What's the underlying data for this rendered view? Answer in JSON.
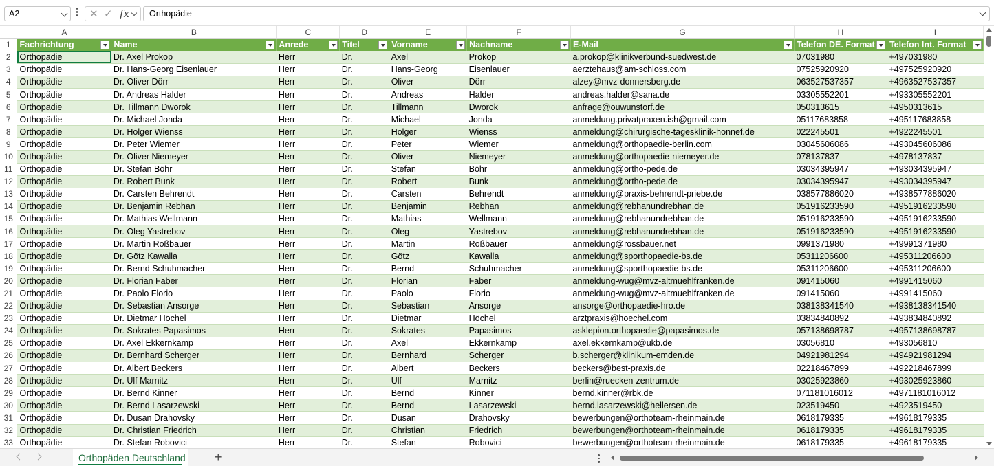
{
  "formula_bar": {
    "name_box": "A2",
    "fx_label": "fx",
    "formula_value": "Orthopädie"
  },
  "columns": [
    "A",
    "B",
    "C",
    "D",
    "E",
    "F",
    "G",
    "H",
    "I"
  ],
  "header_row_number": "1",
  "headers": [
    "Fachrichtung",
    "Name",
    "Anrede",
    "Titel",
    "Vorname",
    "Nachname",
    "E-Mail",
    "Telefon DE. Format",
    "Telefon Int. Format"
  ],
  "rows": [
    {
      "n": "2",
      "cells": [
        "Orthopädie",
        "Dr. Axel Prokop",
        "Herr",
        "Dr.",
        "Axel",
        "Prokop",
        "a.prokop@klinikverbund-suedwest.de",
        "07031980",
        "+497031980"
      ]
    },
    {
      "n": "3",
      "cells": [
        "Orthopädie",
        "Dr. Hans-Georg Eisenlauer",
        "Herr",
        "Dr.",
        "Hans-Georg",
        "Eisenlauer",
        "aerztehaus@am-schloss.com",
        "07525920920",
        "+497525920920"
      ]
    },
    {
      "n": "4",
      "cells": [
        "Orthopädie",
        "Dr. Oliver Dörr",
        "Herr",
        "Dr.",
        "Oliver",
        "Dörr",
        "alzey@mvz-donnersberg.de",
        "063527537357",
        "+4963527537357"
      ]
    },
    {
      "n": "5",
      "cells": [
        "Orthopädie",
        "Dr. Andreas Halder",
        "Herr",
        "Dr.",
        "Andreas",
        "Halder",
        "andreas.halder@sana.de",
        "03305552201",
        "+493305552201"
      ]
    },
    {
      "n": "6",
      "cells": [
        "Orthopädie",
        "Dr. Tillmann Dworok",
        "Herr",
        "Dr.",
        "Tillmann",
        "Dworok",
        "anfrage@ouwunstorf.de",
        "050313615",
        "+4950313615"
      ]
    },
    {
      "n": "7",
      "cells": [
        "Orthopädie",
        "Dr. Michael Jonda",
        "Herr",
        "Dr.",
        "Michael",
        "Jonda",
        "anmeldung.privatpraxen.ish@gmail.com",
        "05117683858",
        "+495117683858"
      ]
    },
    {
      "n": "8",
      "cells": [
        "Orthopädie",
        "Dr. Holger Wienss",
        "Herr",
        "Dr.",
        "Holger",
        "Wienss",
        "anmeldung@chirurgische-tagesklinik-honnef.de",
        "022245501",
        "+4922245501"
      ]
    },
    {
      "n": "9",
      "cells": [
        "Orthopädie",
        "Dr. Peter Wiemer",
        "Herr",
        "Dr.",
        "Peter",
        "Wiemer",
        "anmeldung@orthopaedie-berlin.com",
        "03045606086",
        "+493045606086"
      ]
    },
    {
      "n": "10",
      "cells": [
        "Orthopädie",
        "Dr. Oliver Niemeyer",
        "Herr",
        "Dr.",
        "Oliver",
        "Niemeyer",
        "anmeldung@orthopaedie-niemeyer.de",
        "078137837",
        "+4978137837"
      ]
    },
    {
      "n": "11",
      "cells": [
        "Orthopädie",
        "Dr. Stefan Böhr",
        "Herr",
        "Dr.",
        "Stefan",
        "Böhr",
        "anmeldung@ortho-pede.de",
        "03034395947",
        "+493034395947"
      ]
    },
    {
      "n": "12",
      "cells": [
        "Orthopädie",
        "Dr. Robert Bunk",
        "Herr",
        "Dr.",
        "Robert",
        "Bunk",
        "anmeldung@ortho-pede.de",
        "03034395947",
        "+493034395947"
      ]
    },
    {
      "n": "13",
      "cells": [
        "Orthopädie",
        "Dr. Carsten Behrendt",
        "Herr",
        "Dr.",
        "Carsten",
        "Behrendt",
        "anmeldung@praxis-behrendt-priebe.de",
        "038577886020",
        "+4938577886020"
      ]
    },
    {
      "n": "14",
      "cells": [
        "Orthopädie",
        "Dr. Benjamin Rebhan",
        "Herr",
        "Dr.",
        "Benjamin",
        "Rebhan",
        "anmeldung@rebhanundrebhan.de",
        "051916233590",
        "+4951916233590"
      ]
    },
    {
      "n": "15",
      "cells": [
        "Orthopädie",
        "Dr. Mathias Wellmann",
        "Herr",
        "Dr.",
        "Mathias",
        "Wellmann",
        "anmeldung@rebhanundrebhan.de",
        "051916233590",
        "+4951916233590"
      ]
    },
    {
      "n": "16",
      "cells": [
        "Orthopädie",
        "Dr. Oleg Yastrebov",
        "Herr",
        "Dr.",
        "Oleg",
        "Yastrebov",
        "anmeldung@rebhanundrebhan.de",
        "051916233590",
        "+4951916233590"
      ]
    },
    {
      "n": "17",
      "cells": [
        "Orthopädie",
        "Dr. Martin Roßbauer",
        "Herr",
        "Dr.",
        "Martin",
        "Roßbauer",
        "anmeldung@rossbauer.net",
        "0991371980",
        "+49991371980"
      ]
    },
    {
      "n": "18",
      "cells": [
        "Orthopädie",
        "Dr. Götz Kawalla",
        "Herr",
        "Dr.",
        "Götz",
        "Kawalla",
        "anmeldung@sporthopaedie-bs.de",
        "05311206600",
        "+495311206600"
      ]
    },
    {
      "n": "19",
      "cells": [
        "Orthopädie",
        "Dr. Bernd Schuhmacher",
        "Herr",
        "Dr.",
        "Bernd",
        "Schuhmacher",
        "anmeldung@sporthopaedie-bs.de",
        "05311206600",
        "+495311206600"
      ]
    },
    {
      "n": "20",
      "cells": [
        "Orthopädie",
        "Dr. Florian Faber",
        "Herr",
        "Dr.",
        "Florian",
        "Faber",
        "anmeldung-wug@mvz-altmuehlfranken.de",
        "091415060",
        "+4991415060"
      ]
    },
    {
      "n": "21",
      "cells": [
        "Orthopädie",
        "Dr. Paolo Florio",
        "Herr",
        "Dr.",
        "Paolo",
        "Florio",
        "anmeldung-wug@mvz-altmuehlfranken.de",
        "091415060",
        "+4991415060"
      ]
    },
    {
      "n": "22",
      "cells": [
        "Orthopädie",
        "Dr. Sebastian Ansorge",
        "Herr",
        "Dr.",
        "Sebastian",
        "Ansorge",
        "ansorge@orthopaedie-hro.de",
        "038138341540",
        "+4938138341540"
      ]
    },
    {
      "n": "23",
      "cells": [
        "Orthopädie",
        "Dr. Dietmar Höchel",
        "Herr",
        "Dr.",
        "Dietmar",
        "Höchel",
        "arztpraxis@hoechel.com",
        "03834840892",
        "+493834840892"
      ]
    },
    {
      "n": "24",
      "cells": [
        "Orthopädie",
        "Dr. Sokrates Papasimos",
        "Herr",
        "Dr.",
        "Sokrates",
        "Papasimos",
        "asklepion.orthopaedie@papasimos.de",
        "057138698787",
        "+4957138698787"
      ]
    },
    {
      "n": "25",
      "cells": [
        "Orthopädie",
        "Dr. Axel Ekkernkamp",
        "Herr",
        "Dr.",
        "Axel",
        "Ekkernkamp",
        "axel.ekkernkamp@ukb.de",
        "03056810",
        "+493056810"
      ]
    },
    {
      "n": "26",
      "cells": [
        "Orthopädie",
        "Dr. Bernhard Scherger",
        "Herr",
        "Dr.",
        "Bernhard",
        "Scherger",
        "b.scherger@klinikum-emden.de",
        "04921981294",
        "+494921981294"
      ]
    },
    {
      "n": "27",
      "cells": [
        "Orthopädie",
        "Dr. Albert Beckers",
        "Herr",
        "Dr.",
        "Albert",
        "Beckers",
        "beckers@best-praxis.de",
        "02218467899",
        "+492218467899"
      ]
    },
    {
      "n": "28",
      "cells": [
        "Orthopädie",
        "Dr. Ulf Marnitz",
        "Herr",
        "Dr.",
        "Ulf",
        "Marnitz",
        "berlin@ruecken-zentrum.de",
        "03025923860",
        "+493025923860"
      ]
    },
    {
      "n": "29",
      "cells": [
        "Orthopädie",
        "Dr. Bernd Kinner",
        "Herr",
        "Dr.",
        "Bernd",
        "Kinner",
        "bernd.kinner@rbk.de",
        "071181016012",
        "+4971181016012"
      ]
    },
    {
      "n": "30",
      "cells": [
        "Orthopädie",
        "Dr. Bernd Lasarzewski",
        "Herr",
        "Dr.",
        "Bernd",
        "Lasarzewski",
        "bernd.lasarzewski@hellersen.de",
        "023519450",
        "+4923519450"
      ]
    },
    {
      "n": "31",
      "cells": [
        "Orthopädie",
        "Dr. Dusan Drahovsky",
        "Herr",
        "Dr.",
        "Dusan",
        "Drahovsky",
        "bewerbungen@orthoteam-rheinmain.de",
        "0618179335",
        "+49618179335"
      ]
    },
    {
      "n": "32",
      "cells": [
        "Orthopädie",
        "Dr. Christian Friedrich",
        "Herr",
        "Dr.",
        "Christian",
        "Friedrich",
        "bewerbungen@orthoteam-rheinmain.de",
        "0618179335",
        "+49618179335"
      ]
    },
    {
      "n": "33",
      "cells": [
        "Orthopädie",
        "Dr. Stefan Robovici",
        "Herr",
        "Dr.",
        "Stefan",
        "Robovici",
        "bewerbungen@orthoteam-rheinmain.de",
        "0618179335",
        "+49618179335"
      ]
    }
  ],
  "sheet_tab": {
    "label": "Orthopäden Deutschland",
    "add_label": "+"
  },
  "colors": {
    "header_green": "#70ad47",
    "band_green": "#e2efda",
    "tab_accent": "#107c41"
  }
}
